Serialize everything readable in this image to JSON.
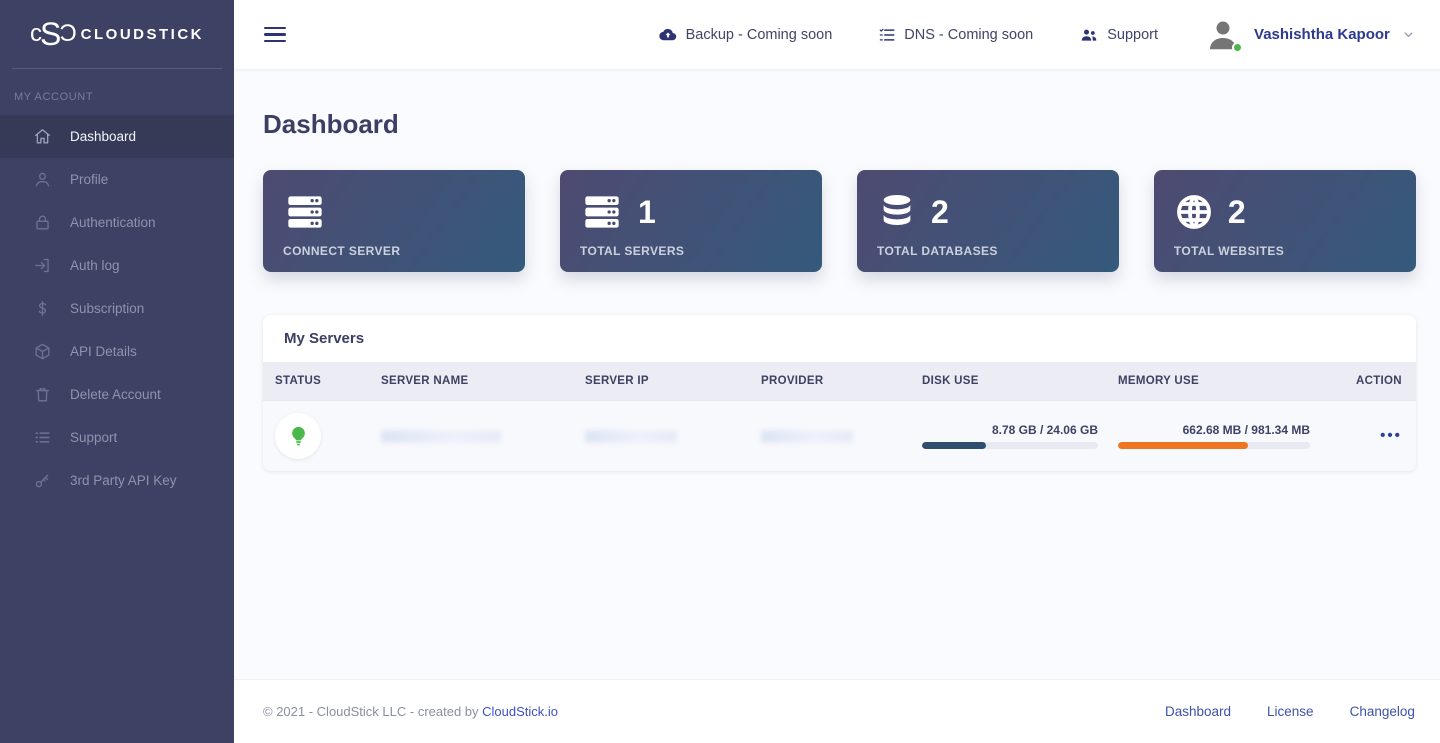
{
  "brand": {
    "name": "CLOUDSTICK",
    "mark": {
      "g1": "c",
      "g2": "S",
      "g3": "Ɔ"
    }
  },
  "sidebar": {
    "section_label": "MY ACCOUNT",
    "items": [
      {
        "label": "Dashboard",
        "icon": "home-icon",
        "active": true
      },
      {
        "label": "Profile",
        "icon": "user-icon",
        "active": false
      },
      {
        "label": "Authentication",
        "icon": "lock-icon",
        "active": false
      },
      {
        "label": "Auth log",
        "icon": "login-icon",
        "active": false
      },
      {
        "label": "Subscription",
        "icon": "dollar-icon",
        "active": false
      },
      {
        "label": "API Details",
        "icon": "package-icon",
        "active": false
      },
      {
        "label": "Delete Account",
        "icon": "trash-icon",
        "active": false
      },
      {
        "label": "Support",
        "icon": "list-icon",
        "active": false
      },
      {
        "label": "3rd Party API Key",
        "icon": "key-icon",
        "active": false
      }
    ]
  },
  "header": {
    "backup_label": "Backup - Coming soon",
    "dns_label": "DNS - Coming soon",
    "support_label": "Support",
    "user_name": "Vashishtha Kapoor",
    "user_status": "online"
  },
  "main": {
    "title": "Dashboard",
    "stat_cards": [
      {
        "label": "CONNECT SERVER",
        "value": "",
        "icon": "server-stack-icon"
      },
      {
        "label": "TOTAL SERVERS",
        "value": "1",
        "icon": "server-stack-icon"
      },
      {
        "label": "TOTAL DATABASES",
        "value": "2",
        "icon": "database-icon"
      },
      {
        "label": "TOTAL WEBSITES",
        "value": "2",
        "icon": "globe-icon"
      }
    ],
    "servers_table": {
      "title": "My Servers",
      "columns": [
        "STATUS",
        "SERVER NAME",
        "SERVER IP",
        "PROVIDER",
        "DISK USE",
        "MEMORY USE",
        "ACTION"
      ],
      "rows": [
        {
          "status": "online",
          "server_name_redacted": true,
          "server_ip_redacted": true,
          "provider_redacted": true,
          "disk": {
            "label": "8.78 GB / 24.06 GB",
            "percent": 36.5
          },
          "memory": {
            "label": "662.68 MB / 981.34 MB",
            "percent": 67.5
          },
          "action": "•••"
        }
      ]
    }
  },
  "footer": {
    "copyright_prefix": "© 2021 - CloudStick LLC - created by ",
    "copyright_link": "CloudStick.io",
    "links": [
      "Dashboard",
      "License",
      "Changelog"
    ]
  },
  "colors": {
    "disk_bar": "#2f4d6d",
    "memory_bar": "#ee7623",
    "status_green": "#4cb84c",
    "accent_navy": "#2d3473",
    "link_blue": "#3f51c5"
  }
}
